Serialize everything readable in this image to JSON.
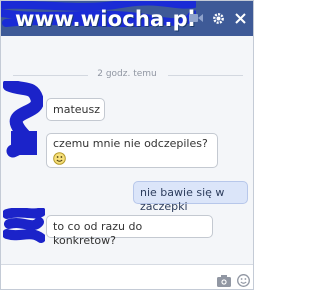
{
  "header": {
    "watermark": "www.wiocha.pl",
    "icons": [
      "video-camera-icon",
      "gear-icon",
      "close-icon"
    ]
  },
  "chat": {
    "timestamp": "2 godz. temu",
    "messages": [
      {
        "side": "in",
        "text": "mateusz"
      },
      {
        "side": "in",
        "text": "czemu mnie nie odczepiles?"
      },
      {
        "side": "out",
        "text": "nie bawie się w zaczepki"
      },
      {
        "side": "in",
        "text": "to co od razu do konkretow?"
      }
    ]
  },
  "composer": {
    "icons": [
      "camera-icon",
      "smiley-icon"
    ]
  }
}
